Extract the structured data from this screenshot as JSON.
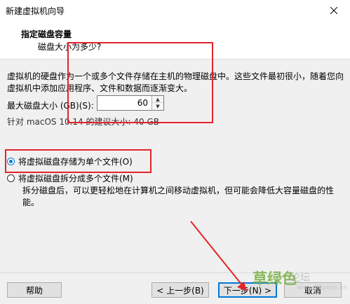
{
  "window": {
    "title": "新建虚拟机向导"
  },
  "header": {
    "title": "指定磁盘容量",
    "subtitle": "磁盘大小为多少?"
  },
  "content": {
    "paragraph": "虚拟机的硬盘作为一个或多个文件存储在主机的物理磁盘中。这些文件最初很小，随着您向虚拟机中添加应用程序、文件和数据而逐渐变大。",
    "max_size_label": "最大磁盘大小 (GB)(S):",
    "max_size_value": "60",
    "recommend": "针对 macOS 10.14 的建议大小: 40 GB",
    "option_single": "将虚拟磁盘存储为单个文件(O)",
    "option_multi": "将虚拟磁盘拆分成多个文件(M)",
    "split_desc": "拆分磁盘后，可以更轻松地在计算机之间移动虚拟机，但可能会降低大容量磁盘的性能。"
  },
  "footer": {
    "help": "帮助",
    "back": "< 上一步(B)",
    "next": "下一步(N) >",
    "cancel": "取消"
  },
  "watermark": {
    "brand": "草绿色",
    "forum": "论坛",
    "url": "www.52pojie.cn"
  },
  "colors": {
    "annotation": "#e3242b",
    "accent": "#0078d7"
  }
}
